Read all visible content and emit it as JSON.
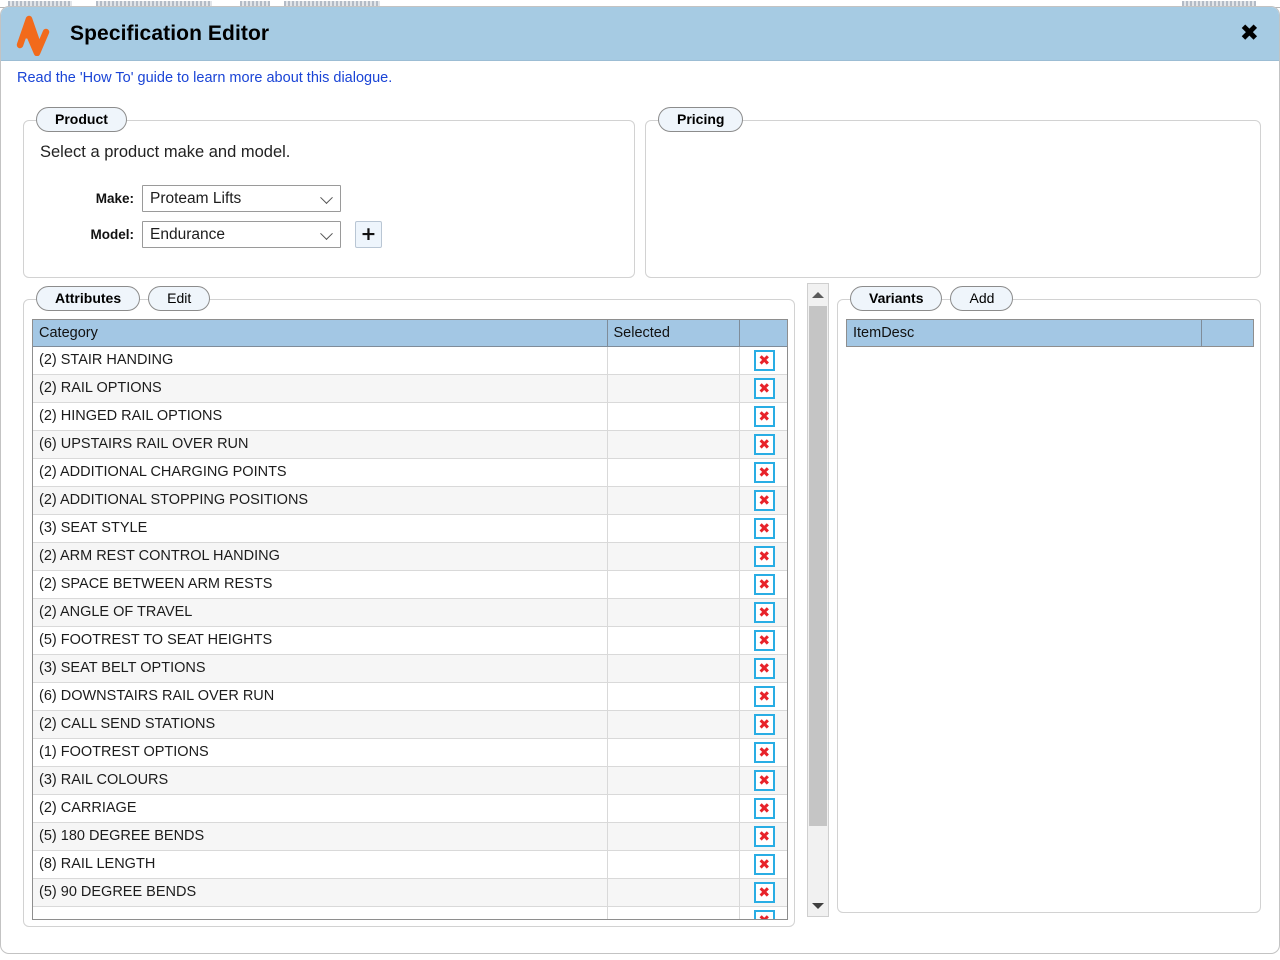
{
  "window": {
    "title": "Specification Editor",
    "logo_icon": "av-logo-icon",
    "close_icon": "close-icon",
    "header_color": "#a6cbe3",
    "logo_color": "#f26a1b"
  },
  "howto": {
    "text": "Read the 'How To' guide to learn more about this dialogue.",
    "color": "#1a44d6"
  },
  "product": {
    "legend": "Product",
    "help_text": "Select a product make and model.",
    "make_label": "Make:",
    "make_value": "Proteam Lifts",
    "model_label": "Model:",
    "model_value": "Endurance",
    "add_button_label": "+",
    "chevron_icon": "chevron-down-icon"
  },
  "pricing": {
    "legend": "Pricing"
  },
  "attributes": {
    "tabs": [
      {
        "label": "Attributes",
        "active": true
      },
      {
        "label": "Edit",
        "active": false
      }
    ],
    "columns": [
      "Category",
      "Selected",
      ""
    ],
    "delete_icon": "delete-x-icon",
    "rows": [
      {
        "category": "(2) STAIR HANDING",
        "selected": ""
      },
      {
        "category": "(2) RAIL OPTIONS",
        "selected": ""
      },
      {
        "category": "(2) HINGED RAIL OPTIONS",
        "selected": ""
      },
      {
        "category": "(6) UPSTAIRS RAIL OVER RUN",
        "selected": ""
      },
      {
        "category": "(2) ADDITIONAL CHARGING POINTS",
        "selected": ""
      },
      {
        "category": "(2) ADDITIONAL STOPPING POSITIONS",
        "selected": ""
      },
      {
        "category": "(3) SEAT STYLE",
        "selected": ""
      },
      {
        "category": "(2) ARM REST CONTROL HANDING",
        "selected": ""
      },
      {
        "category": "(2) SPACE BETWEEN ARM RESTS",
        "selected": ""
      },
      {
        "category": "(2) ANGLE OF TRAVEL",
        "selected": ""
      },
      {
        "category": "(5) FOOTREST TO SEAT HEIGHTS",
        "selected": ""
      },
      {
        "category": "(3) SEAT BELT OPTIONS",
        "selected": ""
      },
      {
        "category": "(6) DOWNSTAIRS RAIL OVER RUN",
        "selected": ""
      },
      {
        "category": "(2) CALL SEND STATIONS",
        "selected": ""
      },
      {
        "category": "(1) FOOTREST OPTIONS",
        "selected": ""
      },
      {
        "category": "(3) RAIL COLOURS",
        "selected": ""
      },
      {
        "category": "(2) CARRIAGE",
        "selected": ""
      },
      {
        "category": "(5) 180 DEGREE BENDS",
        "selected": ""
      },
      {
        "category": "(8) RAIL LENGTH",
        "selected": ""
      },
      {
        "category": "(5) 90 DEGREE BENDS",
        "selected": ""
      },
      {
        "category": "",
        "selected": ""
      }
    ]
  },
  "scrollbar": {
    "up_icon": "scroll-up-arrow-icon",
    "down_icon": "scroll-down-arrow-icon",
    "thumb": "scrollbar-thumb"
  },
  "variants": {
    "tabs": [
      {
        "label": "Variants",
        "active": true
      },
      {
        "label": "Add",
        "active": false
      }
    ],
    "columns": [
      "ItemDesc",
      ""
    ],
    "rows": []
  }
}
